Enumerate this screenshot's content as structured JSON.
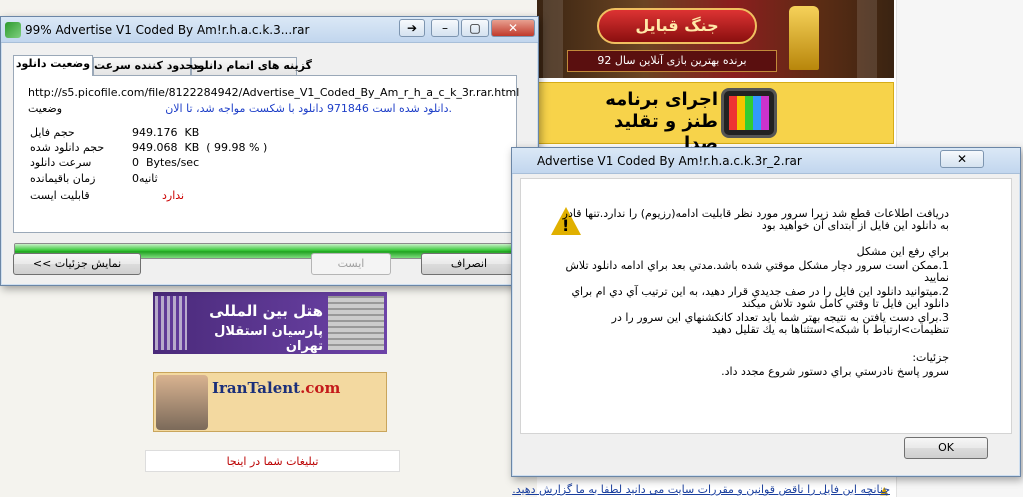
{
  "background_page": {
    "banner_game_caption": "برنده بهترین بازی آنلاین سال 92",
    "banner_game_logo": "جنگ قبایل",
    "banner_show_text": "اجرای برنامه طنز و تقلید صدا",
    "hotel_line1": "هتل بین المللی",
    "hotel_line2": "پارسیان استقلال تهران",
    "talent_brand": "IranTalent",
    "talent_suffix": ".com",
    "ad_here": "تبلیغات شما در اینجا",
    "bottom_link": "چنانچه این فایل را ناقض قوانین و مقررات سایت می دانید لطفا به ما گزارش دهید."
  },
  "download_window": {
    "title": "99% Advertise V1 Coded By Am!r.h.a.c.k.3...rar",
    "tabs": [
      "وضعیت دانلود",
      "محدود کننده سرعت",
      "گزینه های اتمام دانلود"
    ],
    "url": "http://s5.picofile.com/file/8122284942/Advertise_V1_Coded_By_Am_r_h_a_c_k_3r.rar.html",
    "status_label": "وضعیت",
    "status_value": "دانلود شده است 971846 دانلود با شکست مواجه شد، تا الان.",
    "fields": [
      {
        "label": "حجم فایل",
        "value": "949.176  KB"
      },
      {
        "label": "حجم دانلود شده",
        "value": "949.068  KB  ( 99.98 % )"
      },
      {
        "label": "سرعت دانلود",
        "value": "0  Bytes/sec"
      },
      {
        "label": "زمان باقیمانده",
        "value": "0ثانیه"
      },
      {
        "label": "قابلیت ایست",
        "value": "ندارد"
      }
    ],
    "progress_percent": 99.98,
    "buttons": {
      "details": "<< نمایش جزئیات",
      "pause": "ایست",
      "cancel": "انصراف"
    }
  },
  "error_dialog": {
    "title": "Advertise V1 Coded By Am!r.h.a.c.k.3r_2.rar",
    "lines": [
      "دریافت اطلاعات قطع شد زیرا سرور مورد نظر قابلیت ادامه(رزیوم) را ندارد.تنها قادر",
      "به دانلود این فایل از ابتدای آن خواهید بود",
      "",
      "براي رفع اين مشكل",
      "1.ممكن است سرور دچار مشكل موقتي شده باشد.مدتي بعد براي ادامه دانلود تلاش",
      "نماييد",
      "2.ميتوانيد دانلود اين فايل را در صف جديدي قرار دهيد، به اين ترتيب آي دي ام براي",
      "دانلود اين فايل تا وقتي كامل شود تلاش ميكند",
      "3.براي دست يافتن به نتيجه بهتر شما بايد تعداد كانكشنهاي اين سرور را در",
      "تنظيمات>ارتباط با شبكه>استثناها به يك تقليل دهيد",
      "",
      "جزئيات:",
      "سرور پاسخ نادرستي براي دستور شروع مجدد داد."
    ],
    "ok": "OK"
  },
  "colors": {
    "progress": "#21a321",
    "link": "#1e3fc8",
    "warning": "#e0b000"
  }
}
